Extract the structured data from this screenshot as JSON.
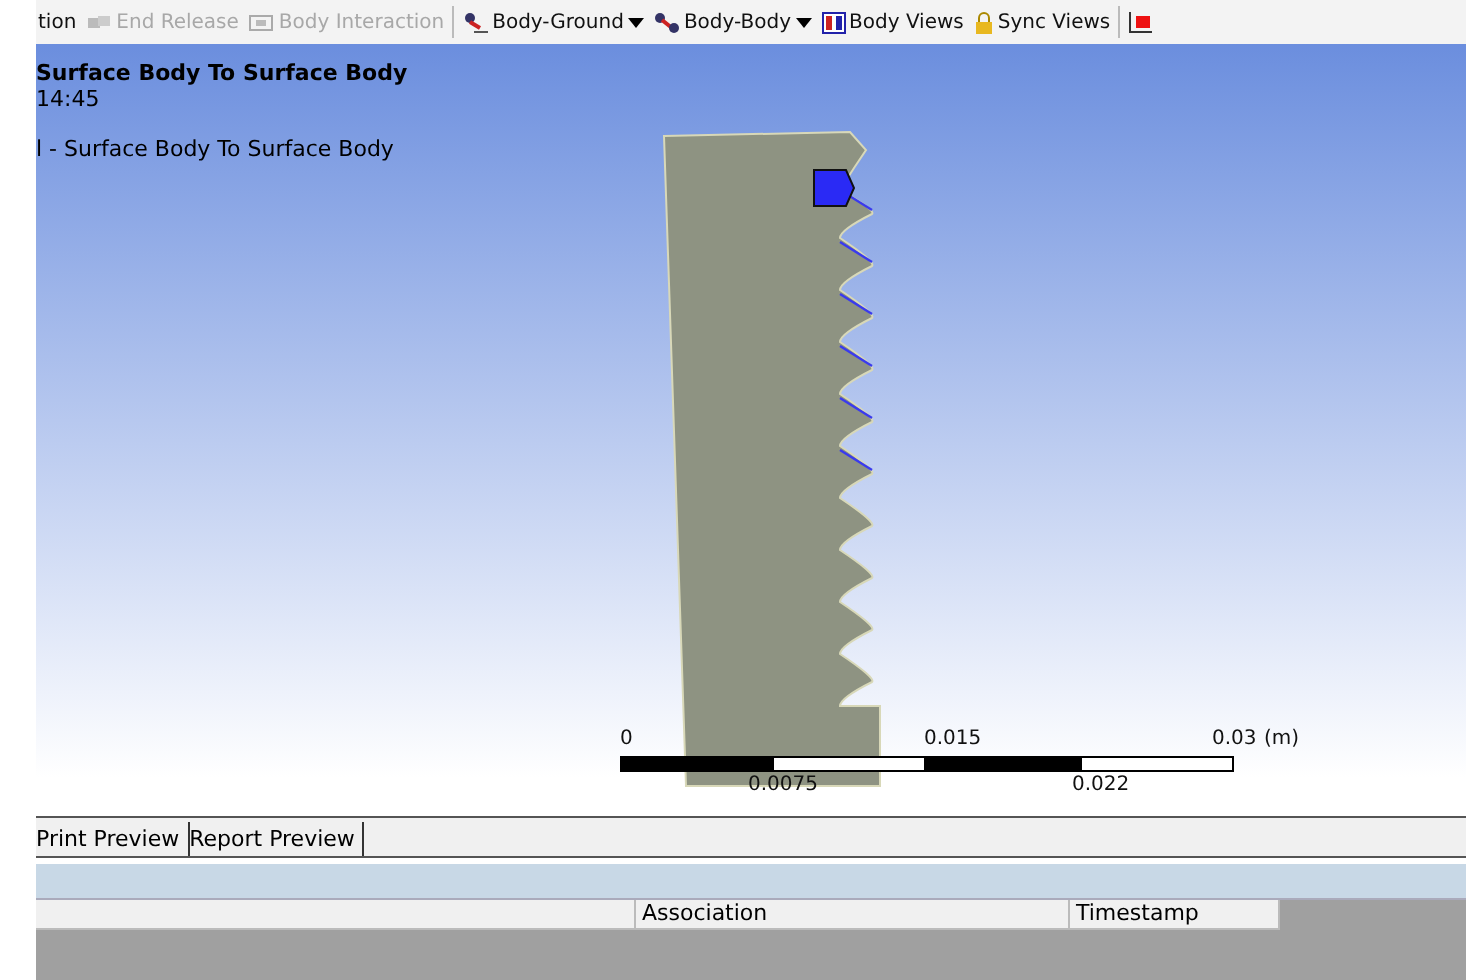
{
  "toolbar": {
    "items": [
      {
        "kind": "button",
        "label": "tion",
        "disabled": false
      },
      {
        "kind": "button",
        "label": "End Release",
        "disabled": true
      },
      {
        "kind": "button",
        "label": "Body Interaction",
        "disabled": true
      },
      {
        "kind": "separator"
      },
      {
        "kind": "dropdown",
        "label": "Body-Ground",
        "disabled": false
      },
      {
        "kind": "dropdown",
        "label": "Body-Body",
        "disabled": false
      },
      {
        "kind": "button",
        "label": "Body Views",
        "disabled": false
      },
      {
        "kind": "button",
        "label": "Sync Views",
        "disabled": false
      },
      {
        "kind": "separator"
      },
      {
        "kind": "icon-only"
      }
    ]
  },
  "viewport": {
    "title": "Surface Body To Surface Body",
    "time": "14:45",
    "subtitle": "l - Surface Body To Surface Body",
    "scale": {
      "top_labels": [
        "0",
        "0.015",
        "0.03"
      ],
      "unit": "(m)",
      "bottom_labels": [
        "0.0075",
        "0.022"
      ]
    }
  },
  "tabs": [
    {
      "label": "Print Preview"
    },
    {
      "label": "Report Preview"
    }
  ],
  "table": {
    "columns": [
      "Association",
      "Timestamp"
    ]
  }
}
